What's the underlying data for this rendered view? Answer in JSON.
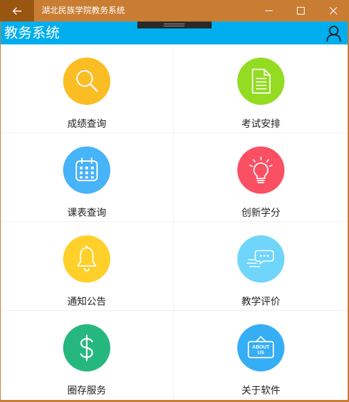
{
  "window": {
    "title": "湖北民族学院教务系统"
  },
  "app": {
    "title": "教务系统"
  },
  "colors": {
    "titlebar": "#c97d33",
    "appbar": "#00aeee"
  },
  "tiles": [
    {
      "label": "成绩查询",
      "icon": "magnifier-icon",
      "color": "#fbbd24"
    },
    {
      "label": "考试安排",
      "icon": "document-icon",
      "color": "#93dc22"
    },
    {
      "label": "课表查询",
      "icon": "calendar-icon",
      "color": "#47b3f8"
    },
    {
      "label": "创新学分",
      "icon": "lightbulb-icon",
      "color": "#fb4f63"
    },
    {
      "label": "通知公告",
      "icon": "bell-icon",
      "color": "#ffd02a"
    },
    {
      "label": "教学评价",
      "icon": "chat-icon",
      "color": "#6fd5fb"
    },
    {
      "label": "圈存服务",
      "icon": "dollar-icon",
      "color": "#26b77f"
    },
    {
      "label": "关于软件",
      "icon": "about-sign-icon",
      "color": "#36aef6"
    }
  ],
  "about_sign": {
    "line1": "ABOUT",
    "line2": "US"
  }
}
